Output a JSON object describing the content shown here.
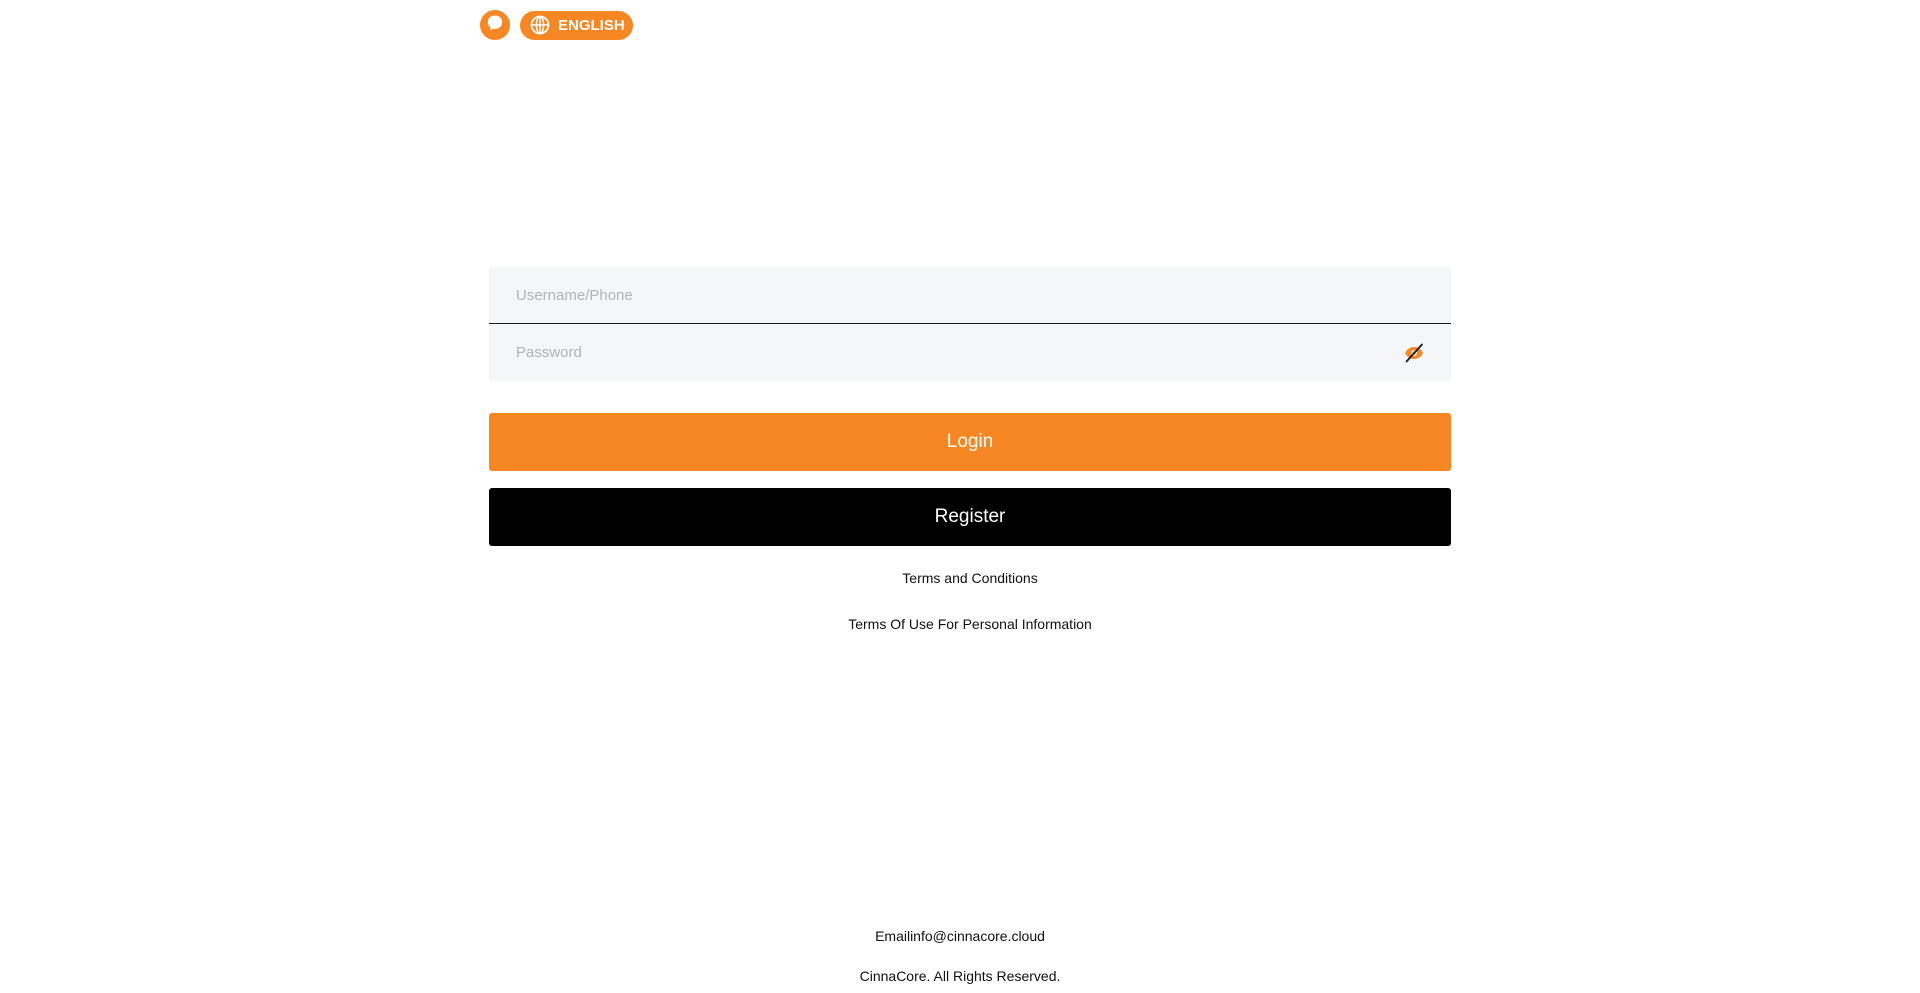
{
  "header": {
    "support_icon": "chat-bubble-icon",
    "language_icon": "globe-icon",
    "language_label": "ENGLISH"
  },
  "login_form": {
    "username_placeholder": "Username/Phone",
    "username_value": "",
    "password_placeholder": "Password",
    "password_value": "",
    "password_toggle_icon": "eye-slash-icon",
    "login_label": "Login",
    "register_label": "Register"
  },
  "links": {
    "terms": "Terms and Conditions",
    "privacy": "Terms Of Use For Personal Information"
  },
  "footer": {
    "email": "Emailinfo@cinnacore.cloud",
    "copyright": "CinnaCore. All Rights Reserved."
  },
  "colors": {
    "accent": "#f68722",
    "register_bg": "#000000",
    "input_bg": "#f5f6f8"
  }
}
